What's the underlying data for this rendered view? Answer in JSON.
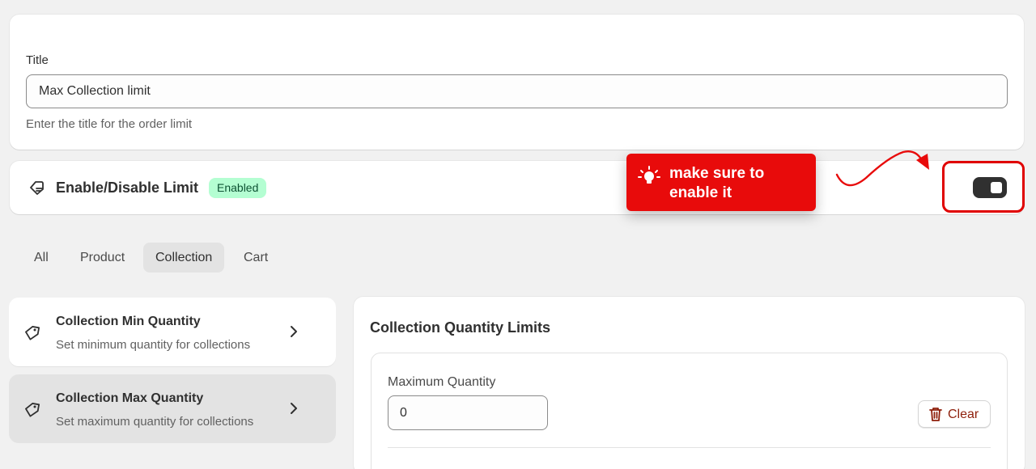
{
  "title_section": {
    "label": "Title",
    "value": "Max Collection limit",
    "help_text": "Enter the title for the order limit"
  },
  "enable_section": {
    "title": "Enable/Disable Limit",
    "status_badge": "Enabled",
    "toggle_on": true,
    "icon": "tag-icon"
  },
  "callout": {
    "text": "make sure to enable it",
    "icon": "lightbulb-icon",
    "color": "#e80b0b"
  },
  "tabs": [
    {
      "label": "All",
      "active": false
    },
    {
      "label": "Product",
      "active": false
    },
    {
      "label": "Collection",
      "active": true
    },
    {
      "label": "Cart",
      "active": false
    }
  ],
  "limit_types": [
    {
      "title": "Collection Min Quantity",
      "subtitle": "Set minimum quantity for collections",
      "selected": false
    },
    {
      "title": "Collection Max Quantity",
      "subtitle": "Set maximum quantity for collections",
      "selected": true
    }
  ],
  "panel": {
    "title": "Collection Quantity Limits",
    "max_label": "Maximum Quantity",
    "max_value": "0",
    "clear_label": "Clear"
  },
  "colors": {
    "badge_bg": "#b4fed2",
    "badge_text": "#0c5132",
    "toggle_on": "#303030",
    "clear_text": "#8e1f0b",
    "highlight": "#e00000"
  }
}
